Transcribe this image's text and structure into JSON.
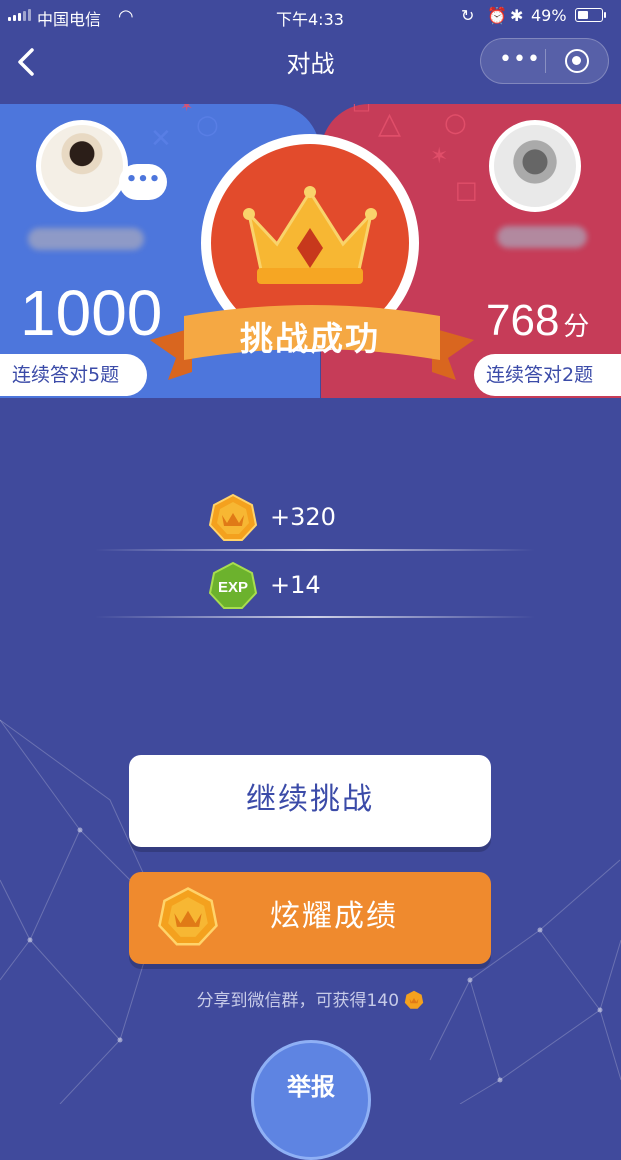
{
  "status_bar": {
    "carrier": "中国电信",
    "time": "下午4:33",
    "battery": "49%",
    "battery_level": 0.49
  },
  "nav": {
    "title": "对战",
    "more_icon": "more-dots-icon",
    "close_icon": "target-circle-icon"
  },
  "battle": {
    "left_player": {
      "score": "1000",
      "streak": "连续答对5题"
    },
    "right_player": {
      "score": "768",
      "score_unit": "分",
      "streak": "连续答对2题"
    },
    "result": "挑战成功",
    "colors": {
      "left": "#4d76dc",
      "right": "#c63c58",
      "crown_bg": "#e24b2c",
      "banner": "#f5a843"
    }
  },
  "rewards": [
    {
      "icon": "crown-coin-icon",
      "value": "+320"
    },
    {
      "icon": "exp-badge-icon",
      "value": "+14"
    }
  ],
  "actions": {
    "continue_label": "继续挑战",
    "share_label": "炫耀成绩",
    "share_note": "分享到微信群，可获得140",
    "report_label": "举报"
  }
}
